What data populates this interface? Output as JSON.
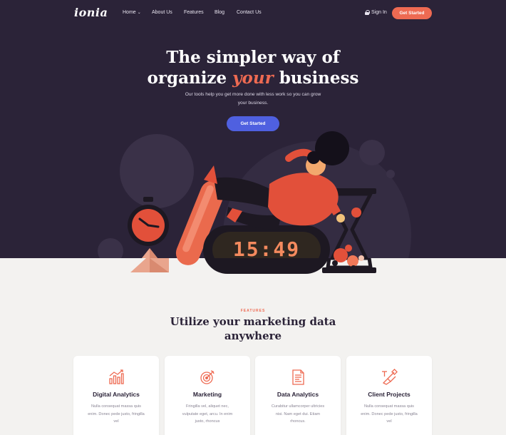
{
  "nav": {
    "logo": "ionia",
    "links": [
      "Home",
      "About Us",
      "Features",
      "Blog",
      "Contact Us"
    ],
    "sign_in": "Sign In",
    "cta": "Get Started"
  },
  "hero": {
    "headline_line1": "The simpler way of",
    "headline_pre": "organize ",
    "headline_highlight": "your",
    "headline_post": " business",
    "subtext": "Our tools help you get more done with less work so you can grow your business.",
    "cta": "Get Started",
    "clock_display": "15:49"
  },
  "features": {
    "eyebrow": "FEATURES",
    "title": "Utilize your marketing data anywhere",
    "cards": [
      {
        "title": "Digital Analytics",
        "icon": "bar-chart-icon",
        "text": "Nulla consequat massa quis enim. Donec pede justo, fringilla vel"
      },
      {
        "title": "Marketing",
        "icon": "target-icon",
        "text": "Fringilla vel, aliquet nec, vulputate eget, arcu. In enim justo, rhoncus"
      },
      {
        "title": "Data Analytics",
        "icon": "document-icon",
        "text": "Curabitur ullamcorper ultricies nisi. Nam eget dui. Etiam rhoncus."
      },
      {
        "title": "Client Projects",
        "icon": "pen-tool-icon",
        "text": "Nulla consequat massa quis enim. Donec pede justo, fringilla vel"
      }
    ]
  },
  "colors": {
    "hero_bg": "#2b2338",
    "accent": "#ee6a52",
    "button_blue": "#4f60e0",
    "page_bg": "#f3f2f0"
  }
}
